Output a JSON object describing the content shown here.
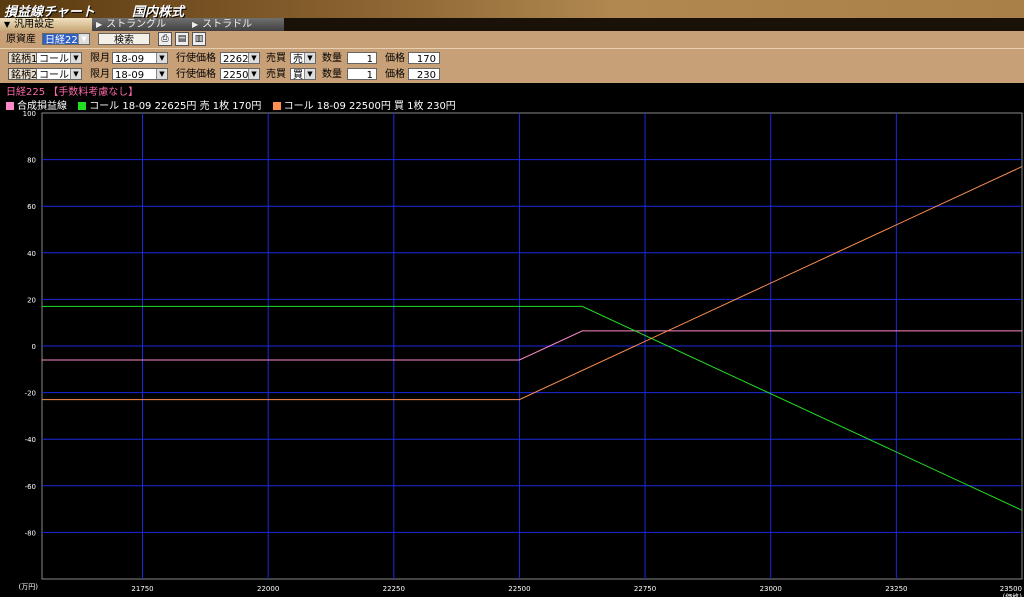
{
  "window": {
    "title": "損益線チャート",
    "subtitle": "国内株式"
  },
  "tabs": [
    {
      "label": "汎用設定"
    },
    {
      "label": "ストラングル"
    },
    {
      "label": "ストラドル"
    }
  ],
  "underlying": {
    "label": "原資産",
    "value": "日経225",
    "search_label": "検索"
  },
  "legs": [
    {
      "button": "銘柄1",
      "type": "コール",
      "month_label": "限月",
      "month": "18-09",
      "strike_label": "行使価格",
      "strike": "22625",
      "side_label": "売買",
      "side": "売",
      "qty_label": "数量",
      "qty": "1",
      "price_label": "価格",
      "price": "170"
    },
    {
      "button": "銘柄2",
      "type": "コール",
      "month_label": "限月",
      "month": "18-09",
      "strike_label": "行使価格",
      "strike": "22500",
      "side_label": "売買",
      "side": "買",
      "qty_label": "数量",
      "qty": "1",
      "price_label": "価格",
      "price": "230"
    }
  ],
  "info": {
    "heading": "日経225 【手数料考慮なし】"
  },
  "colors": {
    "accent": "#c8a078",
    "grid": "#1a2ae0",
    "background": "#000000"
  },
  "chart_data": {
    "type": "line",
    "ylabel": "(万円)",
    "xlabel": "(価格)",
    "xlim": [
      21550,
      23500
    ],
    "ylim": [
      -100,
      100
    ],
    "xticks": [
      21750,
      22000,
      22250,
      22500,
      22750,
      23000,
      23250,
      23500
    ],
    "yticks": [
      100,
      80,
      60,
      40,
      20,
      0,
      -20,
      -40,
      -60,
      -80
    ],
    "grid": true,
    "legend_position": "top-left",
    "series": [
      {
        "name": "合成損益線",
        "color": "#ff88c8",
        "x": [
          21550,
          22500,
          22625,
          23500
        ],
        "y": [
          -6,
          -6,
          6.5,
          6.5
        ]
      },
      {
        "name": "コール 18-09 22625円 売 1枚 170円",
        "color": "#22dd22",
        "x": [
          21550,
          22625,
          23500
        ],
        "y": [
          17,
          17,
          -70.5
        ]
      },
      {
        "name": "コール 18-09 22500円 買 1枚 230円",
        "color": "#ff9050",
        "x": [
          21550,
          22500,
          23500
        ],
        "y": [
          -23,
          -23,
          77
        ]
      }
    ]
  }
}
